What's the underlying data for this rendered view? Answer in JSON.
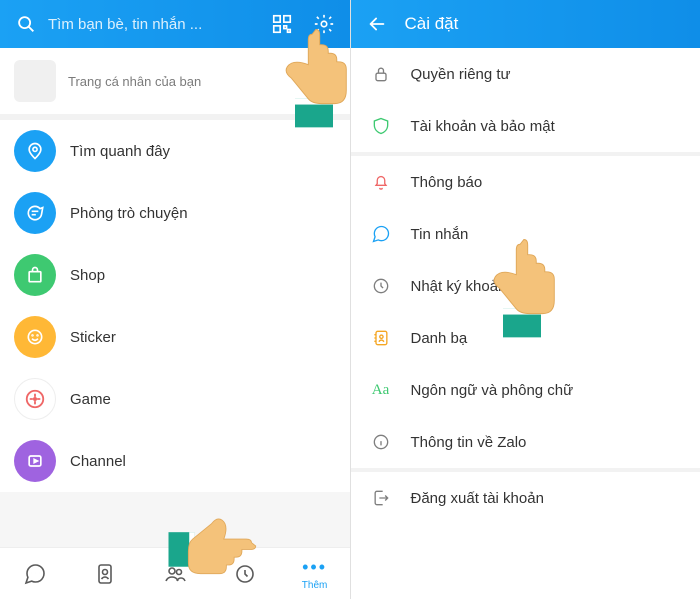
{
  "left": {
    "search_placeholder": "Tìm bạn bè, tin nhắn ...",
    "profile_caption": "Trang cá nhân của bạn",
    "add_badge": "+",
    "menu": [
      {
        "label": "Tìm quanh đây"
      },
      {
        "label": "Phòng trò chuyện"
      },
      {
        "label": "Shop"
      },
      {
        "label": "Sticker"
      },
      {
        "label": "Game"
      },
      {
        "label": "Channel"
      }
    ],
    "tabs": {
      "more_label": "Thêm"
    }
  },
  "right": {
    "title": "Cài đặt",
    "items": [
      {
        "label": "Quyền riêng tư"
      },
      {
        "label": "Tài khoản và bảo mật"
      },
      {
        "label": "Thông báo"
      },
      {
        "label": "Tin nhắn"
      },
      {
        "label": "Nhật ký khoảnh khắc"
      },
      {
        "label": "Danh bạ"
      },
      {
        "label": "Ngôn ngữ và phông chữ"
      },
      {
        "label": "Thông tin về Zalo"
      },
      {
        "label": "Đăng xuất tài khoản"
      }
    ]
  }
}
